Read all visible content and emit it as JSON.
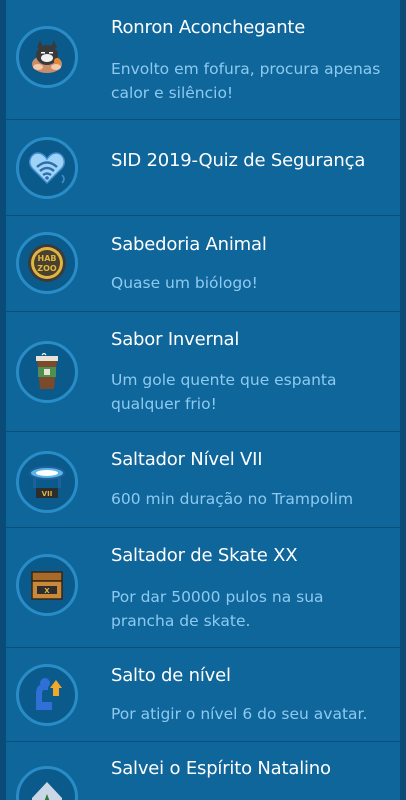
{
  "badges": [
    {
      "title": "Ronron Aconchegante",
      "description": "Envolto em fofura, procura apenas calor e silêncio!",
      "icon": "sleeping-cat-badge-icon"
    },
    {
      "title": "SID 2019-Quiz de Segurança",
      "description": "",
      "icon": "wifi-heart-badge-icon"
    },
    {
      "title": "Sabedoria Animal",
      "description": "Quase um biólogo!",
      "icon": "hab-zoo-coin-badge-icon"
    },
    {
      "title": "Sabor Invernal",
      "description": "Um gole quente que espanta qualquer frio!",
      "icon": "hot-drink-cup-badge-icon"
    },
    {
      "title": "Saltador Nível VII",
      "description": "600 min duração no Trampolim",
      "icon": "trampoline-vii-badge-icon"
    },
    {
      "title": "Saltador de Skate XX",
      "description": "Por dar 50000 pulos na sua prancha de skate.",
      "icon": "skate-chest-xx-badge-icon"
    },
    {
      "title": "Salto de nível",
      "description": "Por atigir o nível 6 do seu avatar.",
      "icon": "level-up-arm-badge-icon"
    },
    {
      "title": "Salvei o Espírito Natalino",
      "description": "",
      "icon": "christmas-spirit-badge-icon"
    }
  ]
}
